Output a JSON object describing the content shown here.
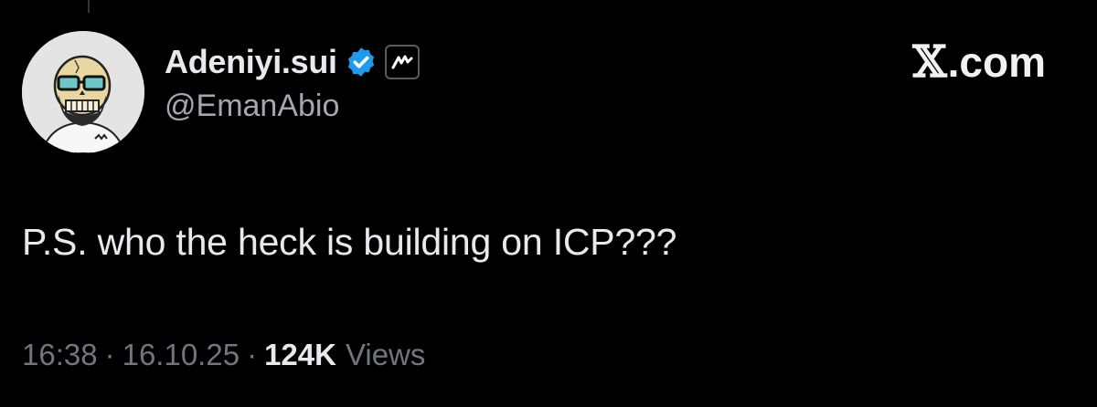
{
  "tweet": {
    "author": {
      "display_name": "Adeniyi.sui",
      "handle": "@EmanAbio",
      "verified": true,
      "verified_color": "#1d9bf0",
      "avatar_icon": "skull-avatar-icon",
      "affiliate_icon": "affiliate-badge-icon"
    },
    "brand": {
      "x_glyph": "𝕏",
      "text": ".com"
    },
    "text": "P.S. who the heck is building on ICP???",
    "meta": {
      "time": "16:38",
      "separator": "·",
      "date": "16.10.25",
      "views_count": "124K",
      "views_label": "Views"
    }
  },
  "colors": {
    "background": "#000000",
    "primary_text": "#e7e9ea",
    "secondary_text": "#71767b",
    "verified_blue": "#1d9bf0"
  }
}
